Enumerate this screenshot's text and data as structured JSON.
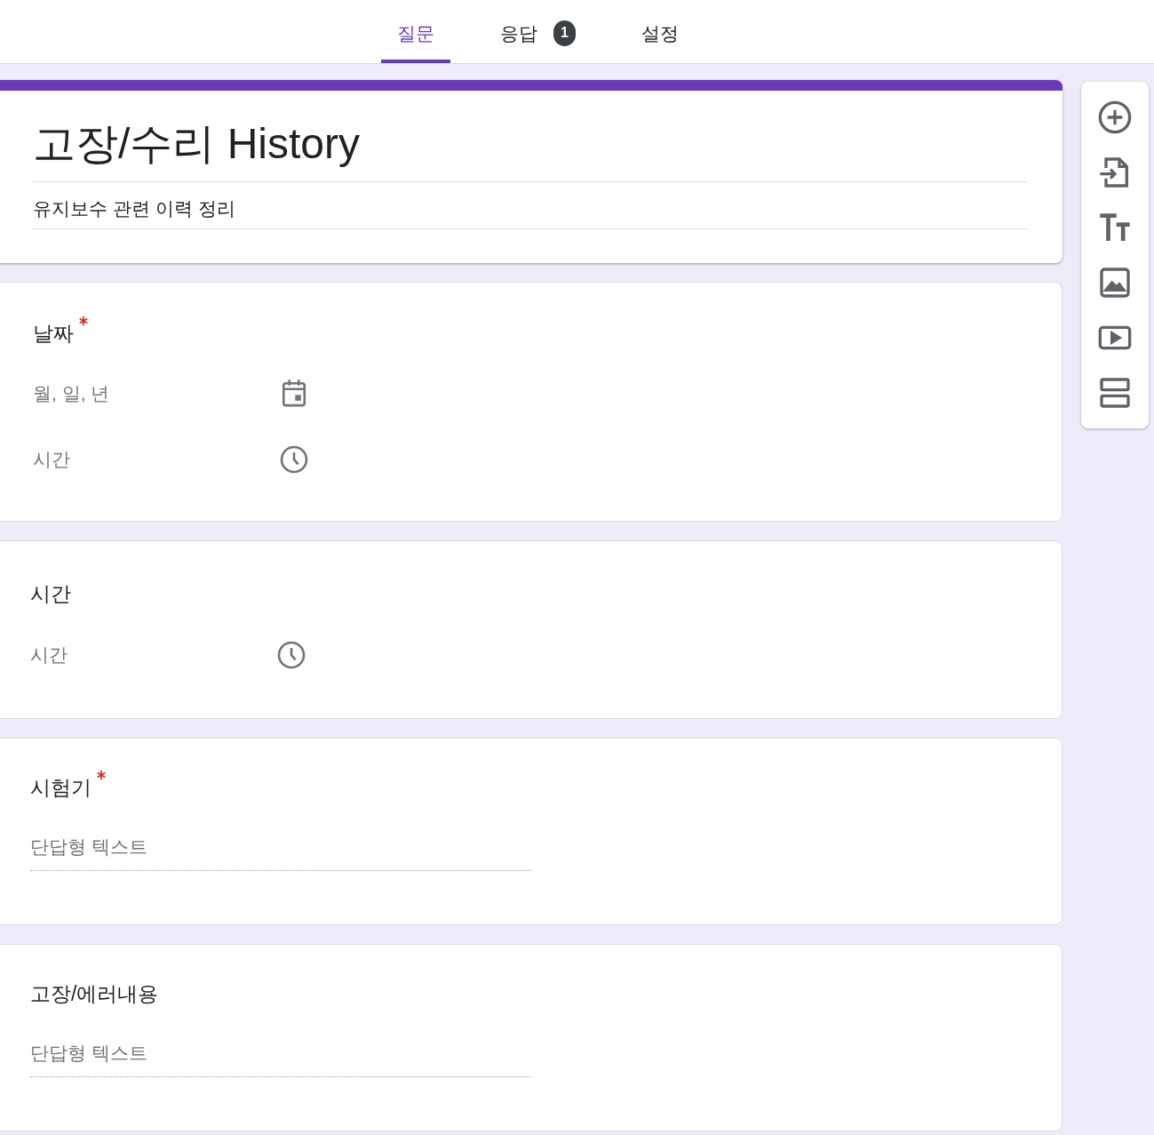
{
  "tabs": [
    {
      "label": "질문",
      "selected": true
    },
    {
      "label": "응답",
      "selected": false,
      "badge": "1"
    },
    {
      "label": "설정",
      "selected": false
    }
  ],
  "header": {
    "title": "고장/수리 History",
    "description": "유지보수 관련 이력 정리"
  },
  "questions": [
    {
      "kind": "date_time",
      "title": "날짜",
      "required": true,
      "selected": true,
      "fields": [
        {
          "kind": "date",
          "placeholder": "월, 일, 년"
        },
        {
          "kind": "time",
          "placeholder": "시간"
        }
      ]
    },
    {
      "kind": "time",
      "title": "시간",
      "required": false,
      "selected": false,
      "fields": [
        {
          "kind": "time",
          "placeholder": "시간"
        }
      ]
    },
    {
      "kind": "short_text",
      "title": "시험기",
      "required": true,
      "selected": false,
      "fields": [
        {
          "kind": "text",
          "placeholder": "단답형 텍스트"
        }
      ]
    },
    {
      "kind": "short_text",
      "title": "고장/에러내용",
      "required": false,
      "selected": false,
      "fields": [
        {
          "kind": "text",
          "placeholder": "단답형 텍스트"
        }
      ]
    }
  ]
}
